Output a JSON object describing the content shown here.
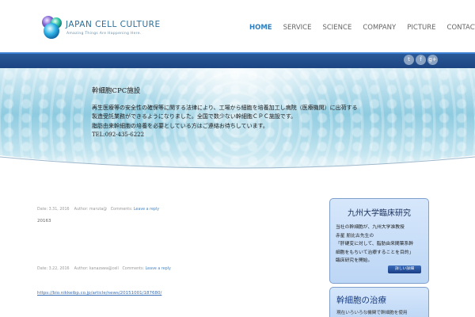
{
  "header": {
    "logo_title": "JAPAN CELL CULTURE",
    "logo_tagline": "Amazing Things Are Happening Here.",
    "nav": [
      "HOME",
      "SERVICE",
      "SCIENCE",
      "COMPANY",
      "PICTURE",
      "CONTACT"
    ],
    "active_nav": "HOME"
  },
  "social": [
    "t",
    "f",
    "g+"
  ],
  "hero": {
    "title": "幹細胞CPC施設",
    "lines": [
      "再生医療等の安全性の確保等に関する法律により、工場から細胞を培養加工し病院（医療機関）に出荷する",
      "製造受託業務ができるようになりました。全国で数少ない幹細胞ＣＰＣ施設です。",
      "脂肪由来幹細胞の培養を必要としている方はご連絡お待ちしています。",
      "TEL:092-435-6222"
    ]
  },
  "posts": [
    {
      "date": "Date: 3.31, 2016",
      "author": "Author: maruta@",
      "comments_label": "Comments:",
      "comments_link": "Leave a reply",
      "body": "20163"
    },
    {
      "date": "Date: 3.22, 2016",
      "author": "Author: kanazawa@cell",
      "comments_label": "Comments:",
      "comments_link": "Leave a reply",
      "body": ""
    }
  ],
  "post_link": "https://bio.nikkeibp.co.jp/article/news/20151001/187680/",
  "sidebar": {
    "box1": {
      "title": "九州大学臨床研究",
      "lines": [
        "当社の幹細胞が、九州大学准教授",
        "赤星 朋比古先生の",
        "「肝硬変に対して、脂肪由来間葉系幹",
        "細胞をもちいて治療することを目的」",
        "臨床研究を開始。"
      ],
      "button": "詳しい詳細"
    },
    "box2": {
      "title": "幹細胞の治療",
      "text": "現在いろいろな機関で幹細胞を使用"
    }
  },
  "colors": {
    "accent": "#2f7fbf",
    "bar": "#1c4582",
    "sidebar_bg": "#cfe2f9"
  }
}
